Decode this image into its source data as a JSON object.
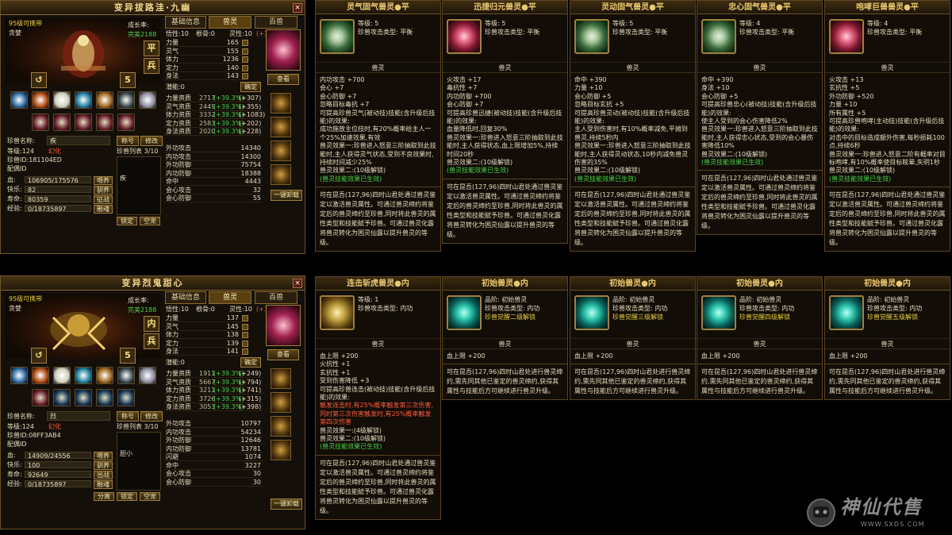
{
  "panels": [
    {
      "title": "变异拔路洼·九幽",
      "tabs": [
        "基础信息",
        "兽灵",
        "百兽"
      ],
      "carry_level": "95级可携带",
      "type": "贪婪",
      "growth_label": "成长率:",
      "growth_value": "完美2188",
      "side_btns": [
        "平",
        "兵"
      ],
      "stats": [
        [
          "悟性:10",
          "根骨:0",
          "灵性:10",
          "(+34.0%)"
        ]
      ],
      "attrs": [
        [
          "力量",
          "165"
        ],
        [
          "灵气",
          "155"
        ],
        [
          "体力",
          "1236"
        ],
        [
          "定力",
          "140"
        ],
        [
          "身法",
          "143"
        ]
      ],
      "potential": "潜能:0",
      "confirm_btn": "确定",
      "view_btn": "查看",
      "aptitudes": [
        [
          "力量资质",
          "2717",
          "(+39.3%)",
          "(+307)"
        ],
        [
          "灵气资质",
          "2449",
          "(+39.3%)",
          "(+355)"
        ],
        [
          "体力资质",
          "3332",
          "(+39.3%)",
          "(+1083)"
        ],
        [
          "定力资质",
          "2583",
          "(+39.3%)",
          "(+202)"
        ],
        [
          "身法资质",
          "2020",
          "(+39.3%)",
          "(+228)"
        ]
      ],
      "combat": [
        [
          "外功攻击",
          "14340"
        ],
        [
          "内功攻击",
          "14300"
        ],
        [
          "外功防御",
          "75754"
        ],
        [
          "内功防御",
          "18388"
        ],
        [
          "命中",
          "4443"
        ],
        [
          "会心攻击",
          "32"
        ],
        [
          "会心防御",
          "55"
        ]
      ],
      "unload_btn": "一键卸载",
      "name_label": "珍兽名称:",
      "name_value": "疾",
      "nickname_btn": "称号",
      "modify_btn": "修改",
      "list_label": "珍兽列表 3/10",
      "info": [
        [
          "等级:124",
          "幻化"
        ],
        [
          "珍兽ID:181104ED",
          ""
        ],
        [
          "配偶ID",
          ""
        ]
      ],
      "bars": [
        [
          "血:",
          "106905/175576",
          "喂养"
        ],
        [
          "快乐:",
          "82",
          "驯养"
        ],
        [
          "寿命:",
          "80359",
          "征战"
        ],
        [
          "经验:",
          "0/18735897",
          "融魂"
        ]
      ],
      "bottom_btns": [
        "锁定",
        "空宠"
      ],
      "pet_name": "疾"
    },
    {
      "title": "变异烈鬼甜心",
      "tabs": [
        "基础信息",
        "兽灵",
        "百兽"
      ],
      "carry_level": "95级可携带",
      "type": "贪婪",
      "growth_label": "成长率:",
      "growth_value": "完美2188",
      "side_btns": [
        "内",
        "兵"
      ],
      "stats": [
        [
          "悟性:10",
          "根骨:0",
          "灵性:10",
          "(+34.0%)"
        ]
      ],
      "attrs": [
        [
          "力量",
          "137"
        ],
        [
          "灵气",
          "145"
        ],
        [
          "体力",
          "138"
        ],
        [
          "定力",
          "139"
        ],
        [
          "身法",
          "141"
        ]
      ],
      "potential": "潜能:0",
      "confirm_btn": "确定",
      "view_btn": "查看",
      "aptitudes": [
        [
          "力量资质",
          "1911",
          "(+39.3%)",
          "(+249)"
        ],
        [
          "灵气资质",
          "5667",
          "(+39.3%)",
          "(+794)"
        ],
        [
          "体力资质",
          "3211",
          "(+39.3%)",
          "(+741)"
        ],
        [
          "定力资质",
          "3726",
          "(+39.3%)",
          "(+315)"
        ],
        [
          "身法资质",
          "3053",
          "(+39.3%)",
          "(+398)"
        ]
      ],
      "combat": [
        [
          "外功攻击",
          "10797"
        ],
        [
          "内功攻击",
          "54234"
        ],
        [
          "外功防御",
          "12646"
        ],
        [
          "内功防御",
          "13781"
        ],
        [
          "闪避",
          "1074"
        ],
        [
          "命中",
          "3227"
        ],
        [
          "会心攻击",
          "30"
        ],
        [
          "会心防御",
          "30"
        ]
      ],
      "unload_btn": "一键卸载",
      "name_label": "珍兽名称:",
      "name_value": "烈",
      "nickname_btn": "称号",
      "modify_btn": "修改",
      "list_label": "珍兽列表 3/10",
      "info": [
        [
          "等级:124",
          "幻化"
        ],
        [
          "珍兽ID:08FF3AB4",
          ""
        ],
        [
          "配偶ID",
          ""
        ]
      ],
      "bars": [
        [
          "血:",
          "14909/24556",
          "喂养"
        ],
        [
          "快乐:",
          "100",
          "驯养"
        ],
        [
          "寿命:",
          "92649",
          "出战"
        ],
        [
          "经验:",
          "0/18735897",
          "融魂"
        ]
      ],
      "bottom_btns": [
        "分离",
        "锁定",
        "空宠"
      ],
      "pet_name": "胆小"
    }
  ],
  "cards_top": [
    {
      "title": "灵气固气兽灵●平",
      "icon": "rose-g",
      "info": [
        "等级: 5",
        "珍兽攻击类型: 平衡"
      ],
      "sub": "兽灵",
      "body": [
        [
          "内功攻击 +700",
          ""
        ],
        [
          "会心 +7",
          ""
        ],
        [
          "会心防御 +7",
          ""
        ],
        [
          "忽略目标毒抗 +7",
          ""
        ],
        [
          "可提高珍兽灵气(被动技)技能(含升级后技能)的效果:",
          ""
        ],
        [
          "成功施放主位技时,有20%概率给主人一个25%加速效果,有效",
          ""
        ],
        [
          "兽灵效果一:珍兽进入怒意三阶抽取到此技能时,主人获得灵气状态,受到不良效果时,持续时间减少25%",
          ""
        ],
        [
          "兽灵效果二:(10级解锁)",
          ""
        ],
        [
          "(兽灵技能效果已生效)",
          "green"
        ]
      ],
      "foot": "可在昆吾(127,96)四时山君处通过兽灵鉴定以激活兽灵属性。可通过兽灵缔约将鉴定后的兽灵缔约至珍兽,同时将此兽灵的属性类型和技能赋予珍兽。可通过兽灵化露将兽灵转化为困灵仙露以提升兽灵的等级。"
    },
    {
      "title": "迅捷归元兽灵●平",
      "icon": "rose-r",
      "info": [
        "等级: 5",
        "珍兽攻击类型: 平衡"
      ],
      "sub": "兽灵",
      "body": [
        [
          "火攻击 +17",
          ""
        ],
        [
          "毒抗性 +7",
          ""
        ],
        [
          "内功防御 +700",
          ""
        ],
        [
          "会心防御 +7",
          ""
        ],
        [
          "可提高珍兽迅捷(被动技)技能(含升级后技能)的效果:",
          ""
        ],
        [
          "血量降低时,回复30%",
          ""
        ],
        [
          "兽灵效果一:珍兽进入怒意三阶抽取到此技能时,主人获得状态,血上限增加5%,持续时间20秒",
          ""
        ],
        [
          "兽灵效果二:(10级解锁)",
          ""
        ],
        [
          "(兽灵技能效果已生效)",
          "green"
        ]
      ],
      "foot": "可在昆吾(127,96)四时山君处通过兽灵鉴定以激活兽灵属性。可通过兽灵缔约将鉴定后的兽灵缔约至珍兽,同时将此兽灵的属性类型和技能赋予珍兽。可通过兽灵化露将兽灵转化为困灵仙露以提升兽灵的等级。"
    },
    {
      "title": "灵动固气兽灵●平",
      "icon": "rose-g",
      "info": [
        "等级: 5",
        "珍兽攻击类型: 平衡"
      ],
      "sub": "兽灵",
      "body": [
        [
          "命中 +390",
          ""
        ],
        [
          "力量 +10",
          ""
        ],
        [
          "会心防御 +5",
          ""
        ],
        [
          "忽略目标玄抗 +5",
          ""
        ],
        [
          "可提高珍兽灵动(被动技)技能(含升级后技能)的效果:",
          ""
        ],
        [
          "主人受到伤害时,有10%概率减免,平摊到兽灵,持续5秒内",
          ""
        ],
        [
          "兽灵效果一:珍兽进入怒意三阶抽取到此技能时,主人获得灵动状态,10秒内减免兽灵伤害的35%",
          ""
        ],
        [
          "兽灵效果二:(10级解锁)",
          ""
        ],
        [
          "(兽灵技能效果已生效)",
          "green"
        ]
      ],
      "foot": "可在昆吾(127,96)四时山君处通过兽灵鉴定以激活兽灵属性。可通过兽灵缔约将鉴定后的兽灵缔约至珍兽,同时将此兽灵的属性类型和技能赋予珍兽。可通过兽灵化露将兽灵转化为困灵仙露以提升兽灵的等级。"
    },
    {
      "title": "忠心固气兽灵●平",
      "icon": "rose-g",
      "info": [
        "等级: 4",
        "珍兽攻击类型: 平衡"
      ],
      "sub": "兽灵",
      "body": [
        [
          "命中 +390",
          ""
        ],
        [
          "身法 +10",
          ""
        ],
        [
          "会心防御 +5",
          ""
        ],
        [
          "可提高珍兽忠心(被动技)技能(含升级后技能)的效果:",
          ""
        ],
        [
          "使主人受到的会心伤害降低2%",
          ""
        ],
        [
          "兽灵效果一:珍兽进入怒意三阶抽取到此技能时,主人获得忠心状态,受到的会心暴伤害降低10%",
          ""
        ],
        [
          "兽灵效果二:(10级解锁)",
          ""
        ],
        [
          "(兽灵技能效果已生效)",
          "green"
        ]
      ],
      "foot": "可在昆吾(127,96)四时山君处通过兽灵鉴定以激活兽灵属性。可通过兽灵缔约将鉴定后的兽灵缔约至珍兽,同时将此兽灵的属性类型和技能赋予珍兽。可通过兽灵化露将兽灵转化为困灵仙露以提升兽灵的等级。"
    },
    {
      "title": "咆哮巨兽兽灵●平",
      "icon": "rose-r",
      "info": [
        "等级: 4",
        "珍兽攻击类型: 平衡"
      ],
      "sub": "兽灵",
      "body": [
        [
          "火攻击 +13",
          ""
        ],
        [
          "玄抗性 +5",
          ""
        ],
        [
          "外功防御 +520",
          ""
        ],
        [
          "力量 +10",
          ""
        ],
        [
          "所有属性 +5",
          ""
        ],
        [
          "可提高珍兽咆哮(主动技)技能(含升级后技能)的效果:",
          ""
        ],
        [
          "对击中的目标造成额外伤害,每秒损耗100点,持续6秒",
          ""
        ],
        [
          "兽灵效果一:珍兽进入怒意二阶有概率对目标咆哮,有10%概率使目标眩晕,失明1秒",
          ""
        ],
        [
          "兽灵效果二:(10级解锁)",
          ""
        ],
        [
          "(兽灵技能效果已生效)",
          "green"
        ]
      ],
      "foot": "可在昆吾(127,96)四时山君处通过兽灵鉴定以激活兽灵属性。可通过兽灵缔约将鉴定后的兽灵缔约至珍兽,同时将此兽灵的属性类型和技能赋予珍兽。可通过兽灵化露将兽灵转化为困灵仙露以提升兽灵的等级。"
    }
  ],
  "cards_bottom": [
    {
      "title": "连击斩虎兽灵●内",
      "icon": "shell",
      "info": [
        "等级: 1",
        "珍兽攻击类型: 内功"
      ],
      "sub": "兽灵",
      "body": [
        [
          "血上限 +200",
          ""
        ],
        [
          "火抗性 +1",
          ""
        ],
        [
          "玄抗性 +1",
          ""
        ],
        [
          "受到伤害降低 +3",
          ""
        ],
        [
          "可提高珍兽连击(被动技)技能(含升级后技能)的效果:",
          ""
        ],
        [
          "触发连击时,有25%概率触发第三次伤害,同时第三次伤害触发时,有25%概率触发第四次伤害",
          "red"
        ],
        [
          "兽灵效果一:(4级解锁)",
          ""
        ],
        [
          "兽灵效果二:(10级解锁)",
          ""
        ],
        [
          "(兽灵技能效果已生效)",
          "green"
        ]
      ],
      "foot": "可在昆吾(127,96)四时山君处通过兽灵鉴定以激活兽灵属性。可通过兽灵缔约将鉴定后的兽灵缔约至珍兽,同时将此兽灵的属性类型和技能赋予珍兽。可通过兽灵化露将兽灵转化为困灵仙露以提升兽灵的等级。"
    },
    {
      "title": "初始兽灵●内",
      "icon": "swirl",
      "info": [
        "品阶: 初始兽灵",
        "珍兽攻击类型: 内功",
        "珍兽觉醒二级解锁"
      ],
      "sub": "兽灵",
      "body": [
        [
          "血上限 +200",
          ""
        ]
      ],
      "foot": "可在昆吾(127,96)四时山君处进行兽灵缔约,需先同其他已鉴定的兽灵缔约,获得其属性与技能后方可继续进行兽灵升级。"
    },
    {
      "title": "初始兽灵●内",
      "icon": "swirl",
      "info": [
        "品阶: 初始兽灵",
        "珍兽攻击类型: 内功",
        "珍兽觉醒三级解锁"
      ],
      "sub": "兽灵",
      "body": [
        [
          "血上限 +200",
          ""
        ]
      ],
      "foot": "可在昆吾(127,96)四时山君处进行兽灵缔约,需先同其他已鉴定的兽灵缔约,获得其属性与技能后方可继续进行兽灵升级。"
    },
    {
      "title": "初始兽灵●内",
      "icon": "swirl",
      "info": [
        "品阶: 初始兽灵",
        "珍兽攻击类型: 内功",
        "珍兽觉醒四级解锁"
      ],
      "sub": "兽灵",
      "body": [
        [
          "血上限 +200",
          ""
        ]
      ],
      "foot": "可在昆吾(127,96)四时山君处进行兽灵缔约,需先同其他已鉴定的兽灵缔约,获得其属性与技能后方可继续进行兽灵升级。"
    },
    {
      "title": "初始兽灵●内",
      "icon": "swirl",
      "info": [
        "品阶: 初始兽灵",
        "珍兽攻击类型: 内功",
        "珍兽觉醒五级解锁"
      ],
      "sub": "兽灵",
      "body": [
        [
          "血上限 +200",
          ""
        ]
      ],
      "foot": "可在昆吾(127,96)四时山君处进行兽灵缔约,需先同其他已鉴定的兽灵缔约,获得其属性与技能后方可继续进行兽灵升级。"
    }
  ],
  "watermark": {
    "brand": "神仙代售",
    "url": "WWW.SXDS.COM"
  }
}
